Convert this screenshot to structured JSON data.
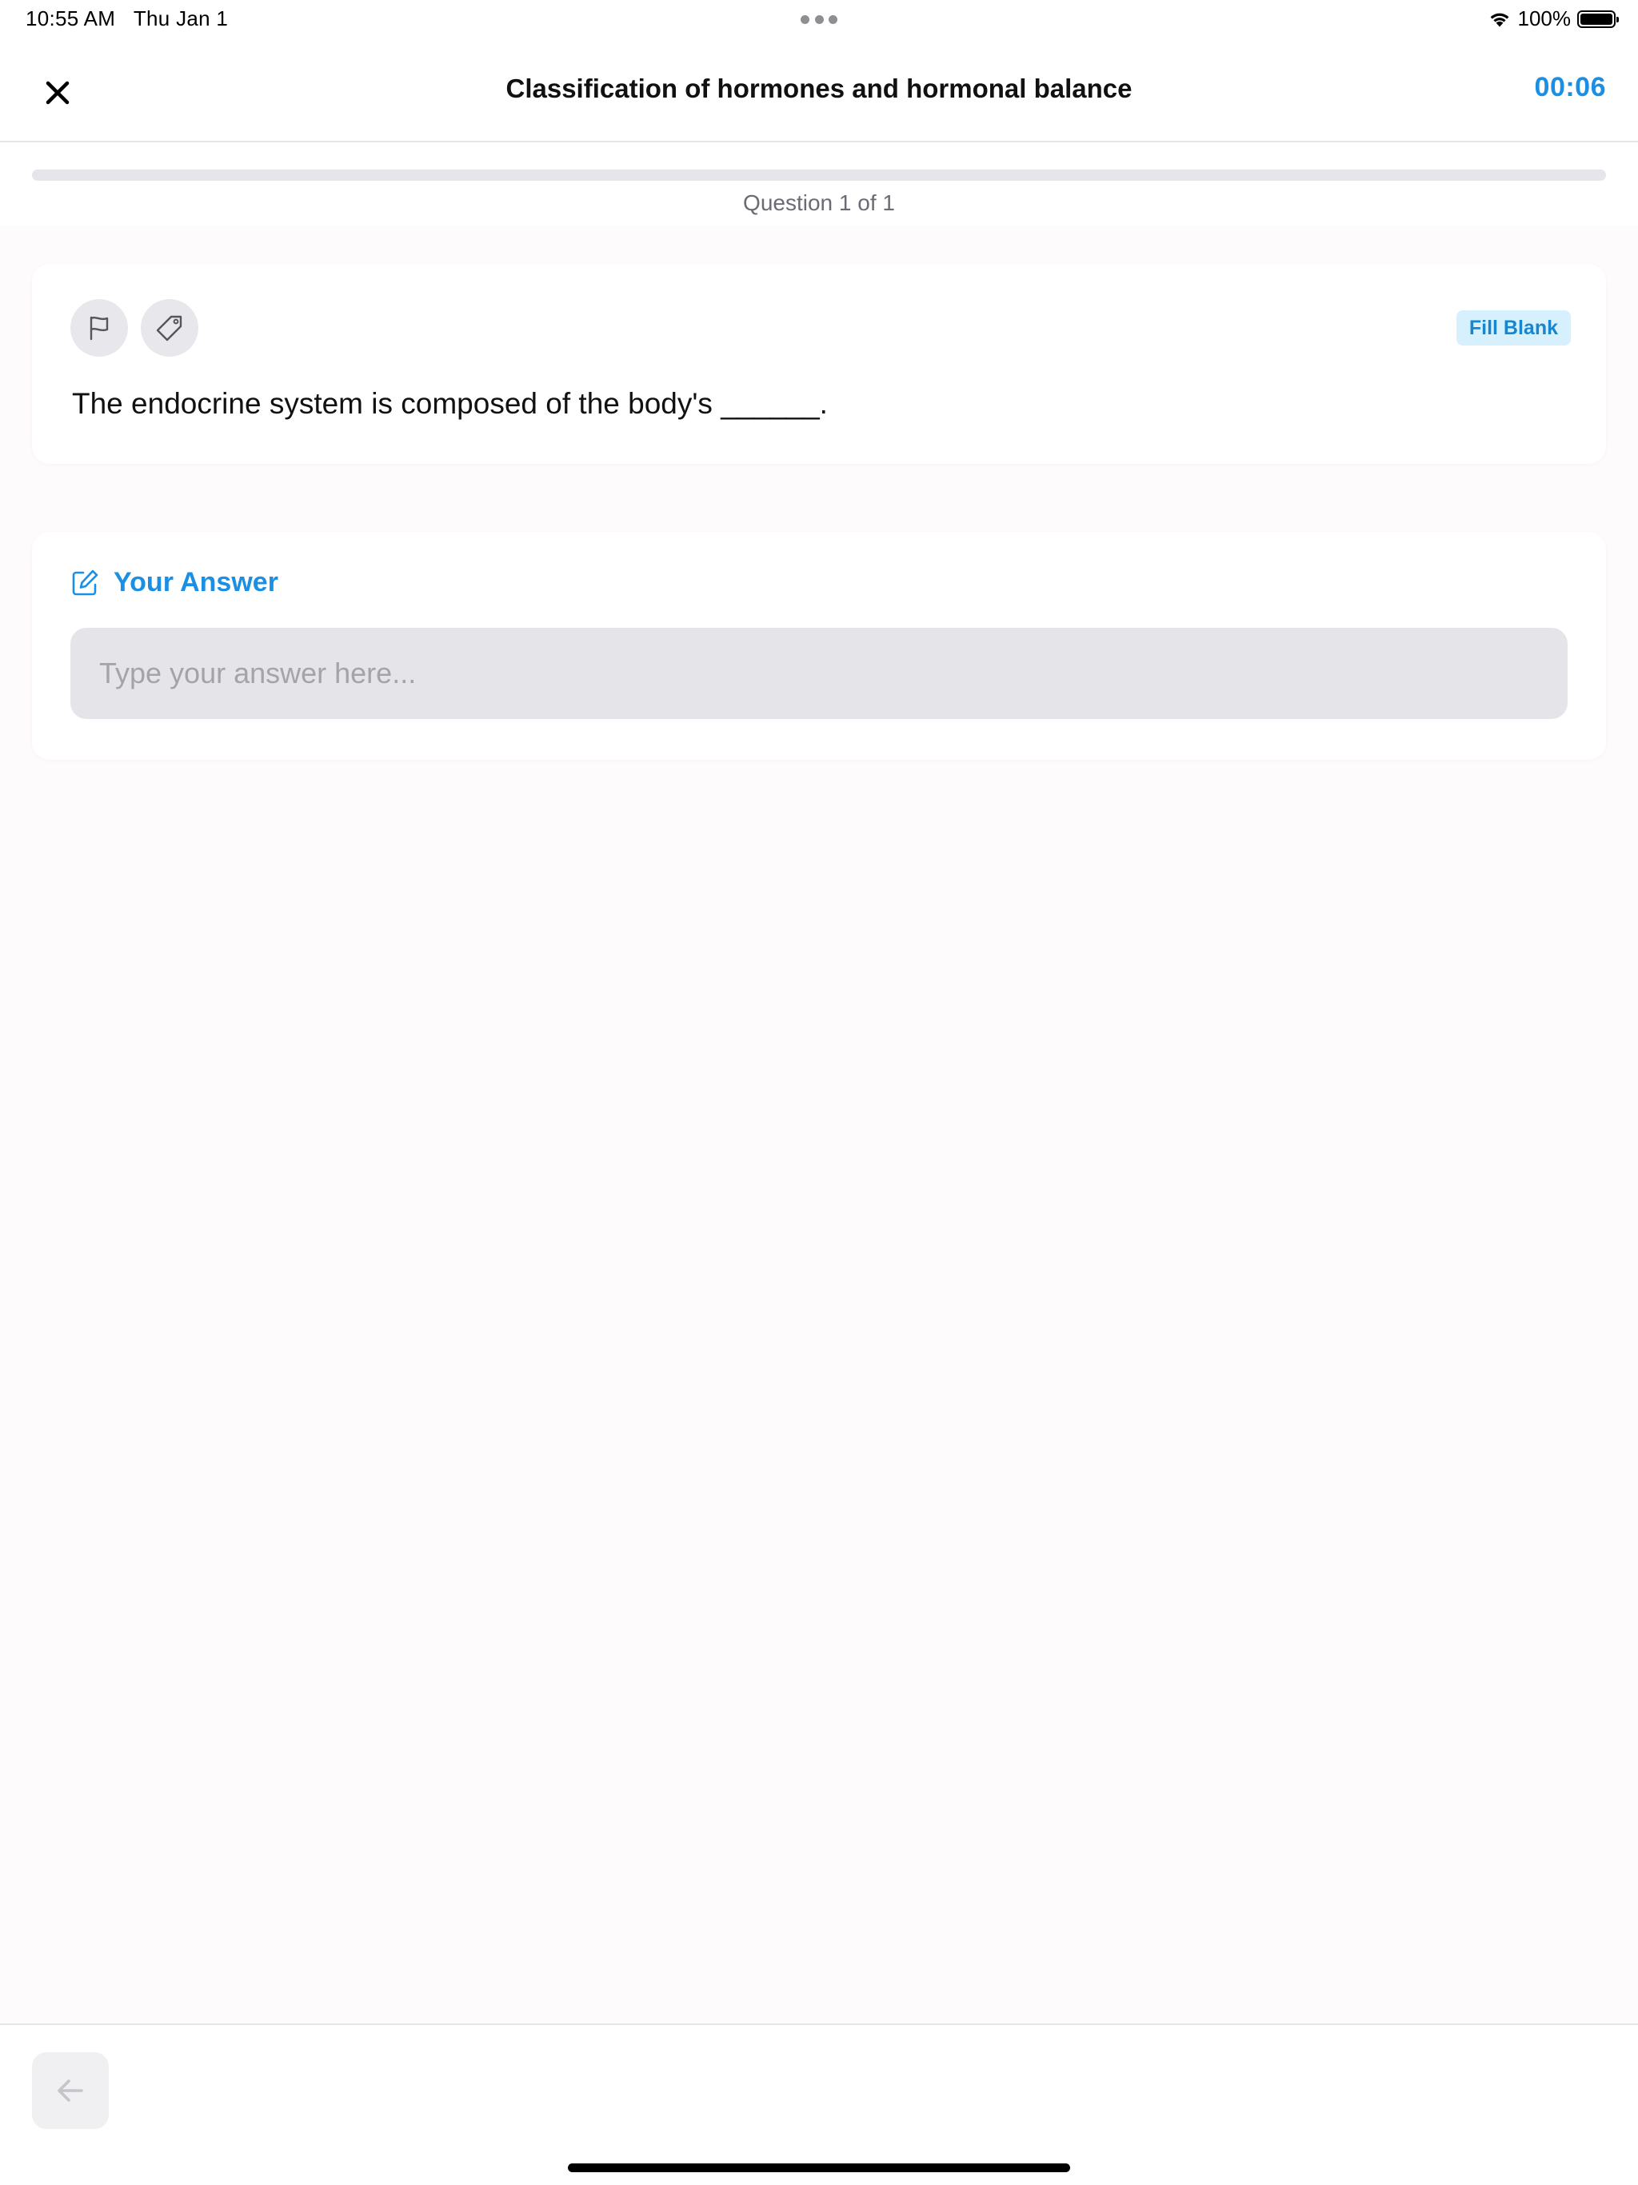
{
  "status_bar": {
    "time": "10:55 AM",
    "date": "Thu Jan 1",
    "battery_percent": "100%",
    "icons": [
      "wifi-icon",
      "battery-icon",
      "more-dots-icon"
    ]
  },
  "header": {
    "title": "Classification of hormones and hormonal balance",
    "timer": "00:06",
    "close_icon": "close-icon"
  },
  "progress": {
    "label": "Question 1 of 1",
    "current": 1,
    "total": 1
  },
  "question": {
    "type_badge": "Fill Blank",
    "text": "The endocrine system is composed of the body's ______.",
    "icons": [
      "flag-icon",
      "tag-icon"
    ]
  },
  "answer": {
    "label": "Your Answer",
    "placeholder": "Type your answer here...",
    "value": "",
    "icon": "edit-icon"
  },
  "footer": {
    "back_icon": "arrow-left-icon"
  },
  "colors": {
    "accent": "#1a8fe3",
    "badge_bg": "#d7f0fd",
    "page_bg": "#fefbfc",
    "input_bg": "#e5e5e9"
  }
}
